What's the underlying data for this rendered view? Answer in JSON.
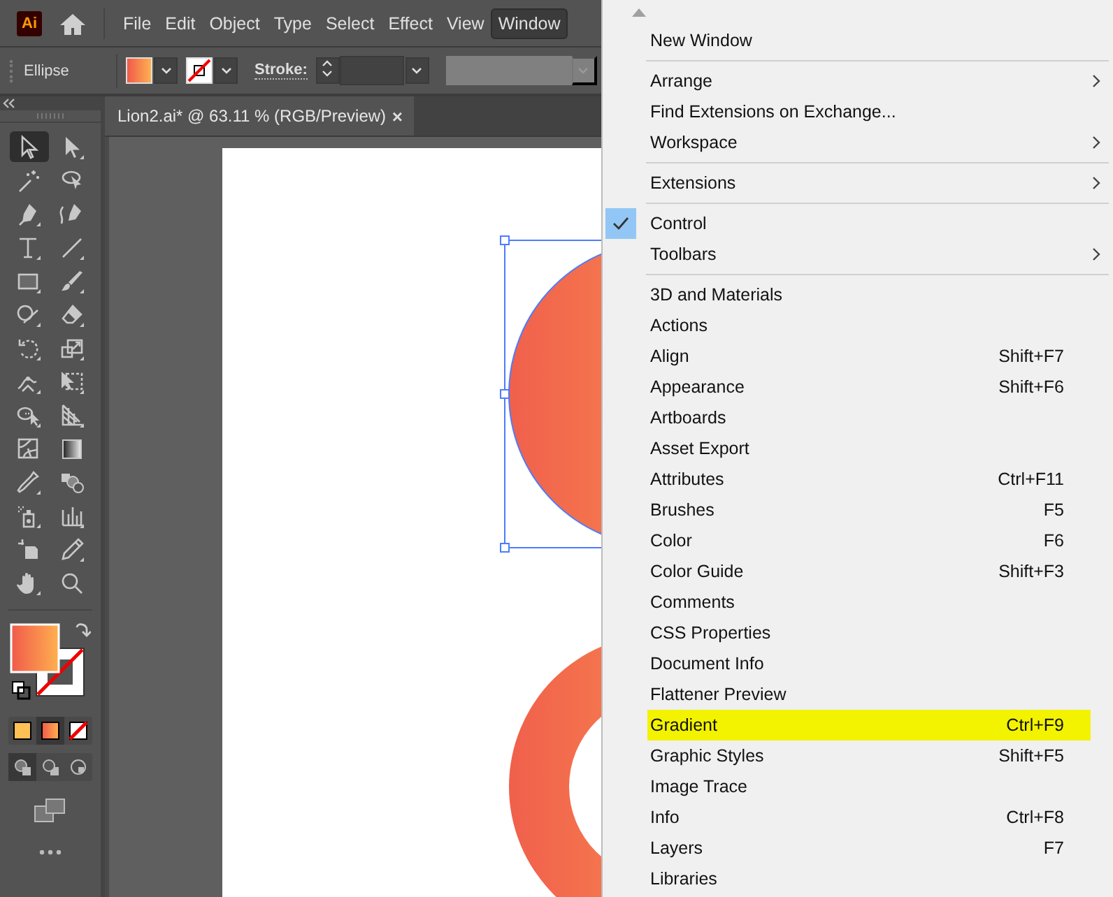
{
  "app": {
    "logo": "Ai"
  },
  "menubar": [
    {
      "label": "File",
      "selected": false
    },
    {
      "label": "Edit",
      "selected": false
    },
    {
      "label": "Object",
      "selected": false
    },
    {
      "label": "Type",
      "selected": false
    },
    {
      "label": "Select",
      "selected": false
    },
    {
      "label": "Effect",
      "selected": false
    },
    {
      "label": "View",
      "selected": false
    },
    {
      "label": "Window",
      "selected": true
    }
  ],
  "control_bar": {
    "tool": "Ellipse",
    "stroke_label": "Stroke:"
  },
  "document_tab": {
    "title": "Lion2.ai* @ 63.11 % (RGB/Preview)",
    "close": "×"
  },
  "tools": [
    {
      "selected": true
    },
    {
      "selected": false
    },
    {
      "selected": false
    },
    {
      "selected": false
    },
    {
      "selected": false
    },
    {
      "selected": false
    },
    {
      "selected": false
    },
    {
      "selected": false
    },
    {
      "selected": false
    },
    {
      "selected": false
    },
    {
      "selected": false
    },
    {
      "selected": false
    },
    {
      "selected": false
    },
    {
      "selected": false
    },
    {
      "selected": false
    },
    {
      "selected": false
    },
    {
      "selected": false
    },
    {
      "selected": false
    },
    {
      "selected": false
    },
    {
      "selected": false
    },
    {
      "selected": false
    },
    {
      "selected": false
    },
    {
      "selected": false
    },
    {
      "selected": false
    },
    {
      "selected": false
    },
    {
      "selected": false
    },
    {
      "selected": false
    },
    {
      "selected": false
    }
  ],
  "color_modes": [
    {
      "selected": false
    },
    {
      "selected": true
    },
    {
      "selected": false
    }
  ],
  "draw_modes": [
    {
      "selected": true
    },
    {
      "selected": false
    },
    {
      "selected": false
    }
  ],
  "menu": {
    "items": [
      {
        "kind": "item",
        "label": "New Window",
        "submenu": false,
        "checked": false,
        "highlighted": false
      },
      {
        "kind": "separator"
      },
      {
        "kind": "item",
        "label": "Arrange",
        "submenu": true,
        "checked": false,
        "highlighted": false
      },
      {
        "kind": "item",
        "label": "Find Extensions on Exchange...",
        "submenu": false,
        "checked": false,
        "highlighted": false
      },
      {
        "kind": "item",
        "label": "Workspace",
        "submenu": true,
        "checked": false,
        "highlighted": false
      },
      {
        "kind": "separator"
      },
      {
        "kind": "item",
        "label": "Extensions",
        "submenu": true,
        "checked": false,
        "highlighted": false
      },
      {
        "kind": "separator"
      },
      {
        "kind": "item",
        "label": "Control",
        "submenu": false,
        "checked": true,
        "highlighted": false
      },
      {
        "kind": "item",
        "label": "Toolbars",
        "submenu": true,
        "checked": false,
        "highlighted": false
      },
      {
        "kind": "separator"
      },
      {
        "kind": "item",
        "label": "3D and Materials",
        "submenu": false,
        "checked": false,
        "highlighted": false
      },
      {
        "kind": "item",
        "label": "Actions",
        "submenu": false,
        "checked": false,
        "highlighted": false
      },
      {
        "kind": "item",
        "label": "Align",
        "shortcut": "Shift+F7",
        "submenu": false,
        "checked": false,
        "highlighted": false
      },
      {
        "kind": "item",
        "label": "Appearance",
        "shortcut": "Shift+F6",
        "submenu": false,
        "checked": false,
        "highlighted": false
      },
      {
        "kind": "item",
        "label": "Artboards",
        "submenu": false,
        "checked": false,
        "highlighted": false
      },
      {
        "kind": "item",
        "label": "Asset Export",
        "submenu": false,
        "checked": false,
        "highlighted": false
      },
      {
        "kind": "item",
        "label": "Attributes",
        "shortcut": "Ctrl+F11",
        "submenu": false,
        "checked": false,
        "highlighted": false
      },
      {
        "kind": "item",
        "label": "Brushes",
        "shortcut": "F5",
        "submenu": false,
        "checked": false,
        "highlighted": false
      },
      {
        "kind": "item",
        "label": "Color",
        "shortcut": "F6",
        "submenu": false,
        "checked": false,
        "highlighted": false
      },
      {
        "kind": "item",
        "label": "Color Guide",
        "shortcut": "Shift+F3",
        "submenu": false,
        "checked": false,
        "highlighted": false
      },
      {
        "kind": "item",
        "label": "Comments",
        "submenu": false,
        "checked": false,
        "highlighted": false
      },
      {
        "kind": "item",
        "label": "CSS Properties",
        "submenu": false,
        "checked": false,
        "highlighted": false
      },
      {
        "kind": "item",
        "label": "Document Info",
        "submenu": false,
        "checked": false,
        "highlighted": false
      },
      {
        "kind": "item",
        "label": "Flattener Preview",
        "submenu": false,
        "checked": false,
        "highlighted": false
      },
      {
        "kind": "item",
        "label": "Gradient",
        "shortcut": "Ctrl+F9",
        "submenu": false,
        "checked": false,
        "highlighted": true
      },
      {
        "kind": "item",
        "label": "Graphic Styles",
        "shortcut": "Shift+F5",
        "submenu": false,
        "checked": false,
        "highlighted": false
      },
      {
        "kind": "item",
        "label": "Image Trace",
        "submenu": false,
        "checked": false,
        "highlighted": false
      },
      {
        "kind": "item",
        "label": "Info",
        "shortcut": "Ctrl+F8",
        "submenu": false,
        "checked": false,
        "highlighted": false
      },
      {
        "kind": "item",
        "label": "Layers",
        "shortcut": "F7",
        "submenu": false,
        "checked": false,
        "highlighted": false
      },
      {
        "kind": "item",
        "label": "Libraries",
        "submenu": false,
        "checked": false,
        "highlighted": false
      }
    ]
  }
}
